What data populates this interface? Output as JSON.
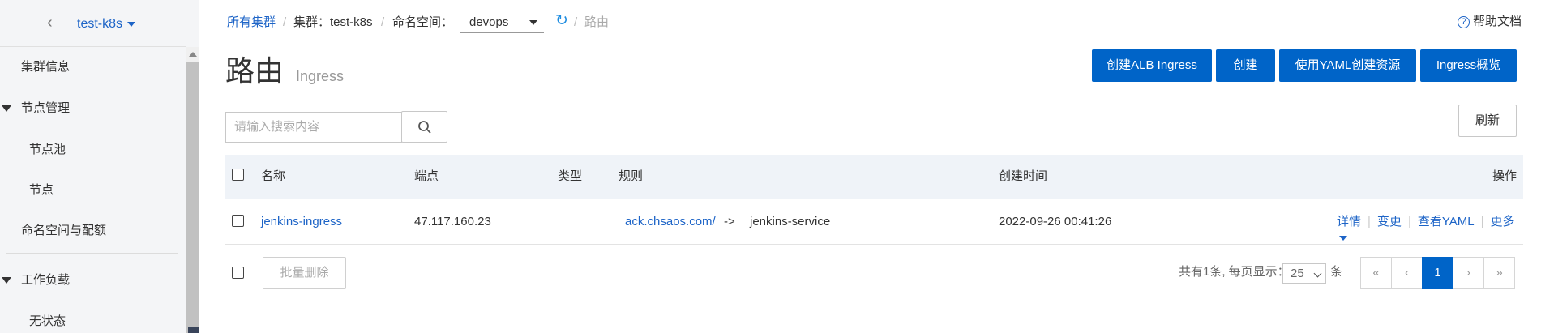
{
  "sidebar": {
    "cluster_name": "test-k8s",
    "items": [
      {
        "label": "集群信息"
      },
      {
        "label": "节点管理"
      },
      {
        "label": "节点池"
      },
      {
        "label": "节点"
      },
      {
        "label": "命名空间与配额"
      },
      {
        "label": "工作负载"
      },
      {
        "label": "无状态"
      }
    ]
  },
  "breadcrumb": {
    "all_clusters": "所有集群",
    "sep": "/",
    "cluster": "集群：test-k8s",
    "namespace_label": "命名空间：",
    "namespace_value": "devops",
    "current": "路由"
  },
  "header": {
    "help": "帮助文档",
    "help_icon": "?",
    "title": "路由",
    "subtitle": "Ingress"
  },
  "toolbar": {
    "create_alb": "创建ALB Ingress",
    "create": "创建",
    "create_yaml": "使用YAML创建资源",
    "ingress_overview": "Ingress概览",
    "search_placeholder": "请输入搜索内容",
    "refresh": "刷新"
  },
  "table": {
    "columns": {
      "name": "名称",
      "endpoint": "端点",
      "type": "类型",
      "rules": "规则",
      "created": "创建时间",
      "actions": "操作"
    },
    "rows": [
      {
        "name": "jenkins-ingress",
        "endpoint": "47.117.160.23",
        "type": "",
        "rule_host": "ack.chsaos.com/",
        "rule_arrow": "->",
        "rule_service": "jenkins-service",
        "created": "2022-09-26 00:41:26",
        "actions": [
          "详情",
          "变更",
          "查看YAML",
          "更多"
        ],
        "action_sep": "|"
      }
    ]
  },
  "footer": {
    "batch_delete": "批量删除",
    "total_info": "共有1条, 每页显示：",
    "page_size": "25",
    "unit": "条",
    "pagination": {
      "first": "«",
      "prev": "‹",
      "current": "1",
      "next": "›",
      "last": "»"
    }
  },
  "colors": {
    "primary": "#0064c8",
    "link": "#1d64c7",
    "table_header_bg": "#eff3f8"
  }
}
